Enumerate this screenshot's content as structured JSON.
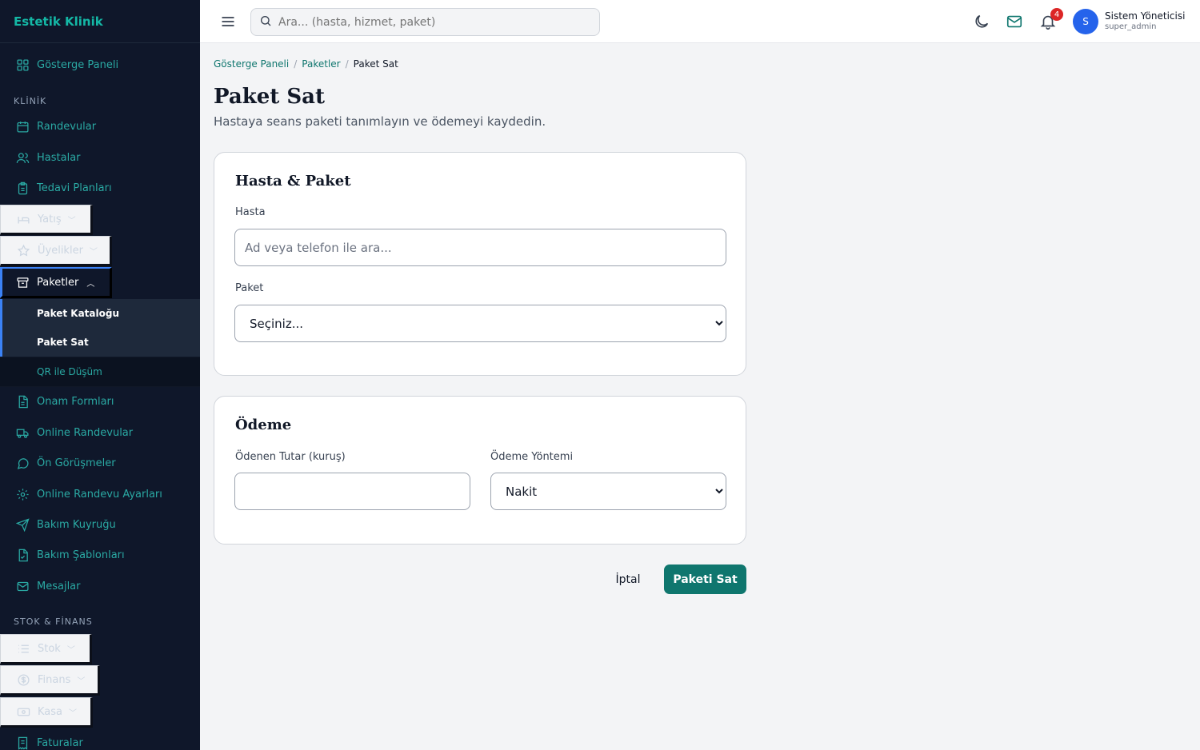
{
  "app": {
    "brand": "Estetik Klinik"
  },
  "sidebar": {
    "dashboard": "Gösterge Paneli",
    "section_clinic": "KLİNİK",
    "appointments": "Randevular",
    "patients": "Hastalar",
    "treatment_plans": "Tedavi Planları",
    "inpatient": "Yatış",
    "memberships": "Üyelikler",
    "packages": "Paketler",
    "package_catalog": "Paket Kataloğu",
    "sell_package": "Paket Sat",
    "qr_deduct": "QR ile Düşüm",
    "consent_forms": "Onam Formları",
    "online_appointments": "Online Randevular",
    "pre_consultations": "Ön Görüşmeler",
    "online_settings": "Online Randevu Ayarları",
    "care_queue": "Bakım Kuyruğu",
    "care_templates": "Bakım Şablonları",
    "messages": "Mesajlar",
    "section_stock": "STOK & FİNANS",
    "stock": "Stok",
    "finance": "Finans",
    "cash": "Kasa",
    "invoices": "Faturalar"
  },
  "topbar": {
    "search_placeholder": "Ara... (hasta, hizmet, paket)",
    "notification_count": "4",
    "avatar_initial": "S",
    "user_name": "Sistem Yöneticisi",
    "user_role": "super_admin"
  },
  "breadcrumb": {
    "home": "Gösterge Paneli",
    "sep": "/",
    "packages": "Paketler",
    "current": "Paket Sat"
  },
  "page": {
    "title": "Paket Sat",
    "subtitle": "Hastaya seans paketi tanımlayın ve ödemeyi kaydedin."
  },
  "patient_package": {
    "title": "Hasta & Paket",
    "patient_label": "Hasta",
    "patient_placeholder": "Ad veya telefon ile ara...",
    "package_label": "Paket",
    "package_selected": "Seçiniz..."
  },
  "payment": {
    "title": "Ödeme",
    "amount_label": "Ödenen Tutar (kuruş)",
    "amount_value": "",
    "method_label": "Ödeme Yöntemi",
    "method_selected": "Nakit"
  },
  "actions": {
    "cancel": "İptal",
    "submit": "Paketi Sat"
  },
  "colors": {
    "sidebar_bg": "#0f172a",
    "accent": "#0f766e",
    "sidebar_text": "#2aa9a3",
    "active_border": "#3b82f6",
    "badge": "#dc2626"
  }
}
